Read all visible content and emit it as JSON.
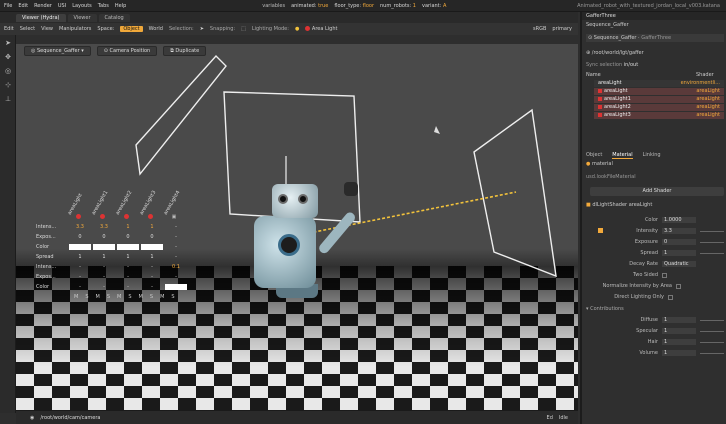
{
  "menubar": {
    "items": [
      "File",
      "Edit",
      "Render",
      "USI",
      "Layouts",
      "Tabs",
      "Help"
    ],
    "variables_label": "variables",
    "variables": [
      {
        "key": "animated",
        "value": "true"
      },
      {
        "key": "floor_type",
        "value": "floor"
      },
      {
        "key": "num_robots",
        "value": "1"
      },
      {
        "key": "variant",
        "value": "A"
      }
    ],
    "document_title": "Animated_robot_with_textured_jordan_local_v003.katana"
  },
  "tabs": [
    "Viewer (Hydra)",
    "Viewer",
    "Catalog"
  ],
  "toolbar": {
    "items": [
      "Edit",
      "Select",
      "View",
      "Manipulators",
      "Space:"
    ],
    "space_active": "Object",
    "space_other": "World",
    "selection_label": "Selection:",
    "snapping_label": "Snapping:",
    "lighting_label": "Lighting Mode:",
    "light_name": "Area Light",
    "render_mode": "sRGB",
    "display": "primary"
  },
  "viewport": {
    "sequence_dropdown": "Sequence_Gaffer",
    "camera_button": "Camera Position",
    "duplicate_button": "Duplicate",
    "camera_path": "/root/world/cam/camera",
    "status_right": [
      "Ed",
      "Idle"
    ]
  },
  "light_panel": {
    "headers": [
      "areaLight",
      "areaLight1",
      "areaLight2",
      "areaLight3",
      "areaLight4"
    ],
    "rows": [
      {
        "label": "Intens...",
        "values": [
          "3.3",
          "3.3",
          "1",
          "1",
          "-"
        ]
      },
      {
        "label": "Expos...",
        "values": [
          "0",
          "0",
          "0",
          "0",
          "-"
        ]
      },
      {
        "label": "Color",
        "values": [
          "",
          "",
          "",
          "",
          "-"
        ]
      },
      {
        "label": "Spread",
        "values": [
          "1",
          "1",
          "1",
          "1",
          "-"
        ]
      },
      {
        "label": "Intens...",
        "values": [
          "-",
          "-",
          "-",
          "-",
          "0.1"
        ]
      },
      {
        "label": "Expos...",
        "values": [
          "-",
          "-",
          "-",
          "-",
          "-"
        ]
      },
      {
        "label": "Color",
        "values": [
          "-",
          "-",
          "-",
          "-",
          ""
        ]
      }
    ],
    "ms_labels": [
      "M",
      "S",
      "M",
      "S",
      "M",
      "S",
      "M",
      "S",
      "M",
      "S"
    ]
  },
  "right_panel": {
    "window_title": "GafferThree",
    "node_name": "Sequence_Gaffer",
    "node_type": "GafferThree",
    "root_location": "/root/world/lgt/gaffer",
    "sync_selection": "Sync selection",
    "sync_value": "in/out",
    "columns": [
      "Name",
      "Shader"
    ],
    "lights": [
      {
        "name": "areaLight",
        "shader": "environmentli...",
        "env": true
      },
      {
        "name": "areaLight",
        "shader": "areaLight"
      },
      {
        "name": "areaLight1",
        "shader": "areaLight"
      },
      {
        "name": "areaLight2",
        "shader": "areaLight"
      },
      {
        "name": "areaLight3",
        "shader": "areaLight"
      }
    ],
    "tabs": [
      "Object",
      "Material",
      "Linking"
    ],
    "material_label": "material",
    "material_node": "usd.lookFileMaterial",
    "add_shader": "Add Shader",
    "shader_line": "dlLightShader",
    "shader_value": "areaLight",
    "props": [
      {
        "label": "Color",
        "value": "1.0000"
      },
      {
        "label": "Intensity",
        "value": "3.3"
      },
      {
        "label": "Exposure",
        "value": "0"
      },
      {
        "label": "Spread",
        "value": "1"
      },
      {
        "label": "Decay Rate",
        "value": "Quadratic"
      },
      {
        "label": "Two Sided",
        "value": ""
      },
      {
        "label": "Normalize Intensity by Area",
        "value": ""
      },
      {
        "label": "Direct Lighting Only",
        "value": ""
      }
    ],
    "contributions_label": "Contributions",
    "contribs": [
      {
        "label": "Diffuse",
        "value": "1"
      },
      {
        "label": "Specular",
        "value": "1"
      },
      {
        "label": "Hair",
        "value": "1"
      },
      {
        "label": "Volume",
        "value": "1"
      }
    ]
  },
  "colors": {
    "accent": "#f2a93b",
    "light_mark": "#d33333"
  }
}
